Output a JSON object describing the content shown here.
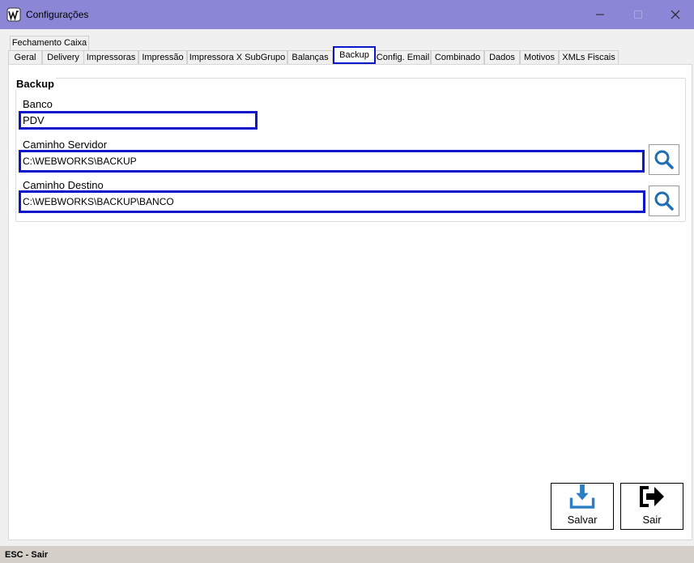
{
  "window": {
    "title": "Configurações",
    "icon": "app-logo-icon",
    "controls": [
      "minimize-icon",
      "maximize-icon",
      "close-icon"
    ]
  },
  "tabs_row1": [
    {
      "label": "Fechamento Caixa"
    }
  ],
  "tabs_row2": [
    {
      "label": "Geral"
    },
    {
      "label": "Delivery"
    },
    {
      "label": "Impressoras"
    },
    {
      "label": "Impressão"
    },
    {
      "label": "Impressora X SubGrupo"
    },
    {
      "label": "Balanças"
    },
    {
      "label": "Backup",
      "active": true
    },
    {
      "label": "Config. Email"
    },
    {
      "label": "Combinado"
    },
    {
      "label": "Dados"
    },
    {
      "label": "Motivos"
    },
    {
      "label": "XMLs Fiscais"
    }
  ],
  "backup": {
    "group_title": "Backup",
    "banco_label": "Banco",
    "banco_value": "PDV",
    "servidor_label": "Caminho Servidor",
    "servidor_value": "C:\\WEBWORKS\\BACKUP",
    "destino_label": "Caminho Destino",
    "destino_value": "C:\\WEBWORKS\\BACKUP\\BANCO"
  },
  "buttons": {
    "salvar_label": "Salvar",
    "salvar_icon": "download-save-icon",
    "sair_label": "Sair",
    "sair_icon": "exit-arrow-icon",
    "search_icon": "search-icon"
  },
  "colors": {
    "titlebar": "#8b87d6",
    "highlight_border": "#0b17c9",
    "search_icon": "#1f6fb2",
    "save_icon": "#2a7fc4"
  },
  "status": {
    "text": "ESC - Sair"
  }
}
